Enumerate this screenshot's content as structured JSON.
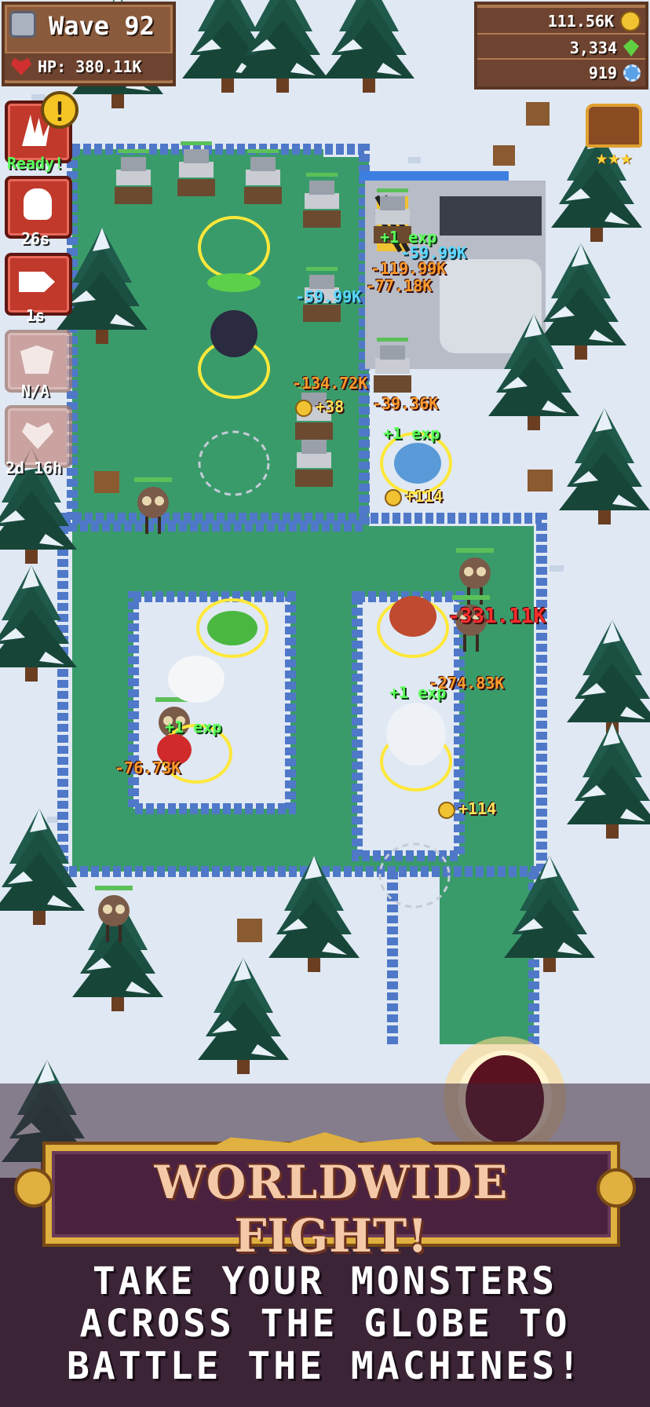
{
  "hud": {
    "wave_label": "Wave 92",
    "hp_label": "HP: 380.11K",
    "coins": "111.56K",
    "gems_green": "3,334",
    "gears_blue": "919"
  },
  "skills": [
    {
      "name": "ready-skill",
      "status": "Ready!",
      "state": "ready"
    },
    {
      "name": "skull-skill",
      "status": "26s",
      "state": "cooldown"
    },
    {
      "name": "bullet-skill",
      "status": "1s",
      "state": "cooldown"
    },
    {
      "name": "mask-skill",
      "status": "N/A",
      "state": "disabled"
    },
    {
      "name": "heart-skill",
      "status": "2d 16h",
      "state": "disabled"
    }
  ],
  "chest": {
    "stars": "★★★"
  },
  "floating_texts": [
    {
      "text": "+1 exp",
      "style": "f-green"
    },
    {
      "text": "-59.99K",
      "style": "f-blue"
    },
    {
      "text": "-119.99K",
      "style": "f-orange"
    },
    {
      "text": "-77.18K",
      "style": "f-orange"
    },
    {
      "text": "-59.99K",
      "style": "f-blue"
    },
    {
      "text": "-134.72K",
      "style": "f-orange"
    },
    {
      "text": "+38",
      "style": "f-gold"
    },
    {
      "text": "-39.36K",
      "style": "f-orange"
    },
    {
      "text": "+1 exp",
      "style": "f-green"
    },
    {
      "text": "+114",
      "style": "f-gold"
    },
    {
      "text": "-331.11K",
      "style": "f-red"
    },
    {
      "text": "-274.83K",
      "style": "f-orange"
    },
    {
      "text": "+1 exp",
      "style": "f-green"
    },
    {
      "text": "+1 exp",
      "style": "f-green"
    },
    {
      "text": "-76.73K",
      "style": "f-orange"
    },
    {
      "text": "+114",
      "style": "f-gold"
    }
  ],
  "banner": {
    "title": "WORLDWIDE FIGHT!",
    "tagline_line1": "TAKE YOUR MONSTERS",
    "tagline_line2": "ACROSS THE GLOBE TO",
    "tagline_line3": "BATTLE THE MACHINES!"
  },
  "colors": {
    "snow": "#dfe8f3",
    "grass": "#3a9b6a",
    "rock": "#4f78c8",
    "tree": "#1f5a4a",
    "banner_bg": "#3a2436",
    "banner_gold": "#e0b040"
  }
}
